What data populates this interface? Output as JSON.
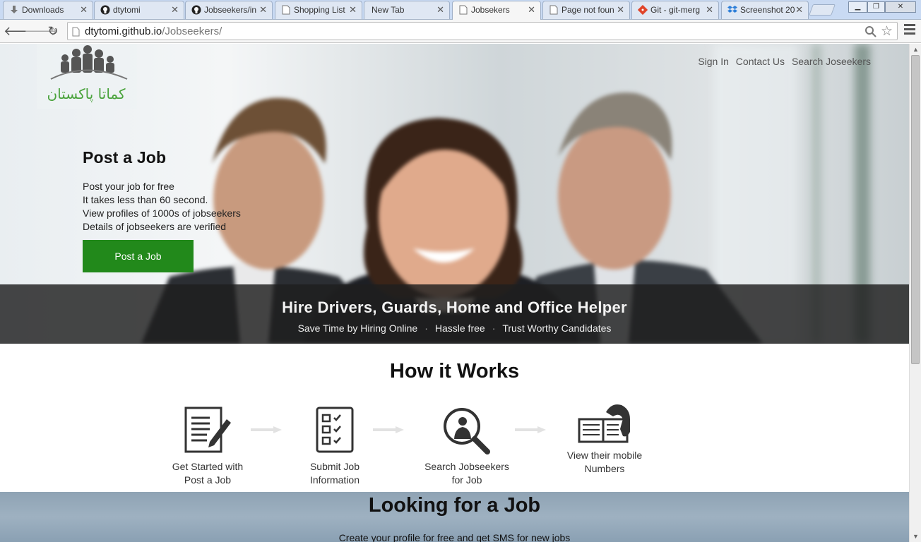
{
  "browser": {
    "tabs": [
      {
        "label": "Downloads",
        "icon": "download-icon",
        "active": false
      },
      {
        "label": "dtytomi",
        "icon": "github-icon",
        "active": false
      },
      {
        "label": "Jobseekers/in",
        "icon": "github-icon",
        "active": false
      },
      {
        "label": "Shopping List",
        "icon": "page-icon",
        "active": false
      },
      {
        "label": "New Tab",
        "icon": "",
        "active": false
      },
      {
        "label": "Jobsekers",
        "icon": "page-icon",
        "active": true
      },
      {
        "label": "Page not foun",
        "icon": "page-icon",
        "active": false
      },
      {
        "label": "Git - git-merg",
        "icon": "git-icon",
        "active": false
      },
      {
        "label": "Screenshot 20",
        "icon": "dropbox-icon",
        "active": false
      }
    ],
    "url_domain": "dtytomi.github.io",
    "url_path": "/Jobseekers/"
  },
  "header": {
    "logo_text": "کماتا پاکستان",
    "nav": [
      "Sign In",
      "Contact Us",
      "Search Joseekers"
    ]
  },
  "hero": {
    "title": "Post a Job",
    "lines": [
      "Post your job for free",
      "It takes less than 60 second.",
      "View profiles of 1000s of jobseekers",
      "Details of jobseekers are verified"
    ],
    "cta": "Post a Job",
    "band_title": "Hire Drivers, Guards, Home and Office Helper",
    "band_points": [
      "Save Time by Hiring Online",
      "Hassle free",
      "Trust Worthy Candidates"
    ]
  },
  "how": {
    "title": "How it Works",
    "steps": [
      {
        "line1": "Get Started with",
        "line2": "Post a Job",
        "icon": "document-pen-icon"
      },
      {
        "line1": "Submit Job",
        "line2": "Information",
        "icon": "checklist-icon"
      },
      {
        "line1": "Search Jobseekers",
        "line2": "for Job",
        "icon": "search-person-icon"
      },
      {
        "line1": "View their mobile",
        "line2": "Numbers",
        "icon": "phonebook-icon"
      }
    ]
  },
  "job_section": {
    "title": "Looking for a Job",
    "subtitle": "Create your profile for free and get SMS for new jobs"
  },
  "colors": {
    "accent_green": "#22891b",
    "band_dark": "#1e1e1e",
    "tabstrip": "#c9daf3"
  }
}
